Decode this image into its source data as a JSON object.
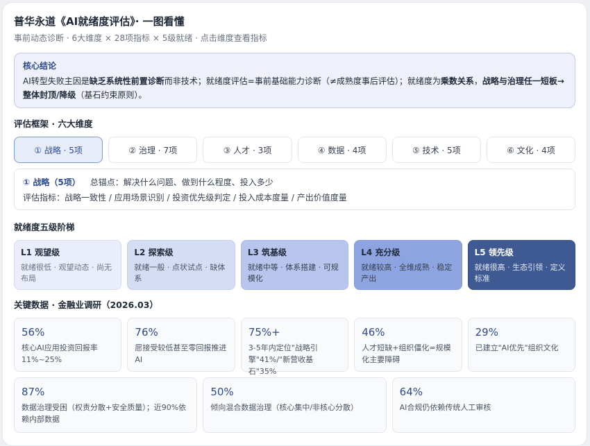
{
  "title": "普华永道《AI就绪度评估》· 一图看懂",
  "subtitle": "事前动态诊断 · 6大维度 × 28项指标 × 5级就绪 · 点击维度查看指标",
  "core": {
    "label": "核心结论",
    "t1": "AI转型失败主因是",
    "b1": "缺乏系统性前置诊断",
    "t2": "而非技术；就绪度评估=事前基础能力诊断（≠成熟度事后评估）；就绪度为",
    "b2": "乘数关系",
    "t3": "，",
    "b3": "战略与治理任一短板→整体封顶/降级",
    "t4": "（基石约束原则）。"
  },
  "framework": {
    "heading": "评估框架 · 六大维度",
    "tabs": [
      {
        "label": "① 战略 · 5项"
      },
      {
        "label": "② 治理 · 7项"
      },
      {
        "label": "③ 人才 · 3项"
      },
      {
        "label": "④ 数据 · 4项"
      },
      {
        "label": "⑤ 技术 · 5项"
      },
      {
        "label": "⑥ 文化 · 4项"
      }
    ],
    "detail": {
      "title": "① 战略（5项）",
      "anchor": "总锚点：解决什么问题、做到什么程度、投入多少",
      "indicators": "评估指标：战略一致性 / 应用场景识别 / 投资优先级判定 / 投入成本度量 / 产出价值度量"
    }
  },
  "levels": {
    "heading": "就绪度五级阶梯",
    "items": [
      {
        "name": "L1 观望级",
        "desc": "就绪很低 · 观望动态 · 尚无布局"
      },
      {
        "name": "L2 探索级",
        "desc": "就绪一般 · 点状试点 · 缺体系"
      },
      {
        "name": "L3 筑基级",
        "desc": "就绪中等 · 体系搭建 · 可规模化"
      },
      {
        "name": "L4 充分级",
        "desc": "就绪较高 · 全维成熟 · 稳定产出"
      },
      {
        "name": "L5 领先级",
        "desc": "就绪很高 · 生态引领 · 定义标准"
      }
    ]
  },
  "stats": {
    "heading": "关键数据 · 金融业调研（2026.03）",
    "row1": [
      {
        "value": "56%",
        "desc": "核心AI应用投资回报率11%~25%"
      },
      {
        "value": "76%",
        "desc": "愿接受较低甚至零回报推进AI"
      },
      {
        "value": "75%+",
        "desc": "3-5年内定位\"战略引擎\"41%/\"新营收基石\"35%"
      },
      {
        "value": "46%",
        "desc": "人才短缺+组织僵化=规模化主要障碍"
      },
      {
        "value": "29%",
        "desc": "已建立\"AI优先\"组织文化"
      }
    ],
    "row2": [
      {
        "value": "87%",
        "desc": "数据治理受困（权责分散+安全质量）；近90%依赖内部数据"
      },
      {
        "value": "50%",
        "desc": "倾向混合数据治理（核心集中/非核心分散）"
      },
      {
        "value": "64%",
        "desc": "AI合规仍依赖传统人工审核"
      }
    ]
  }
}
